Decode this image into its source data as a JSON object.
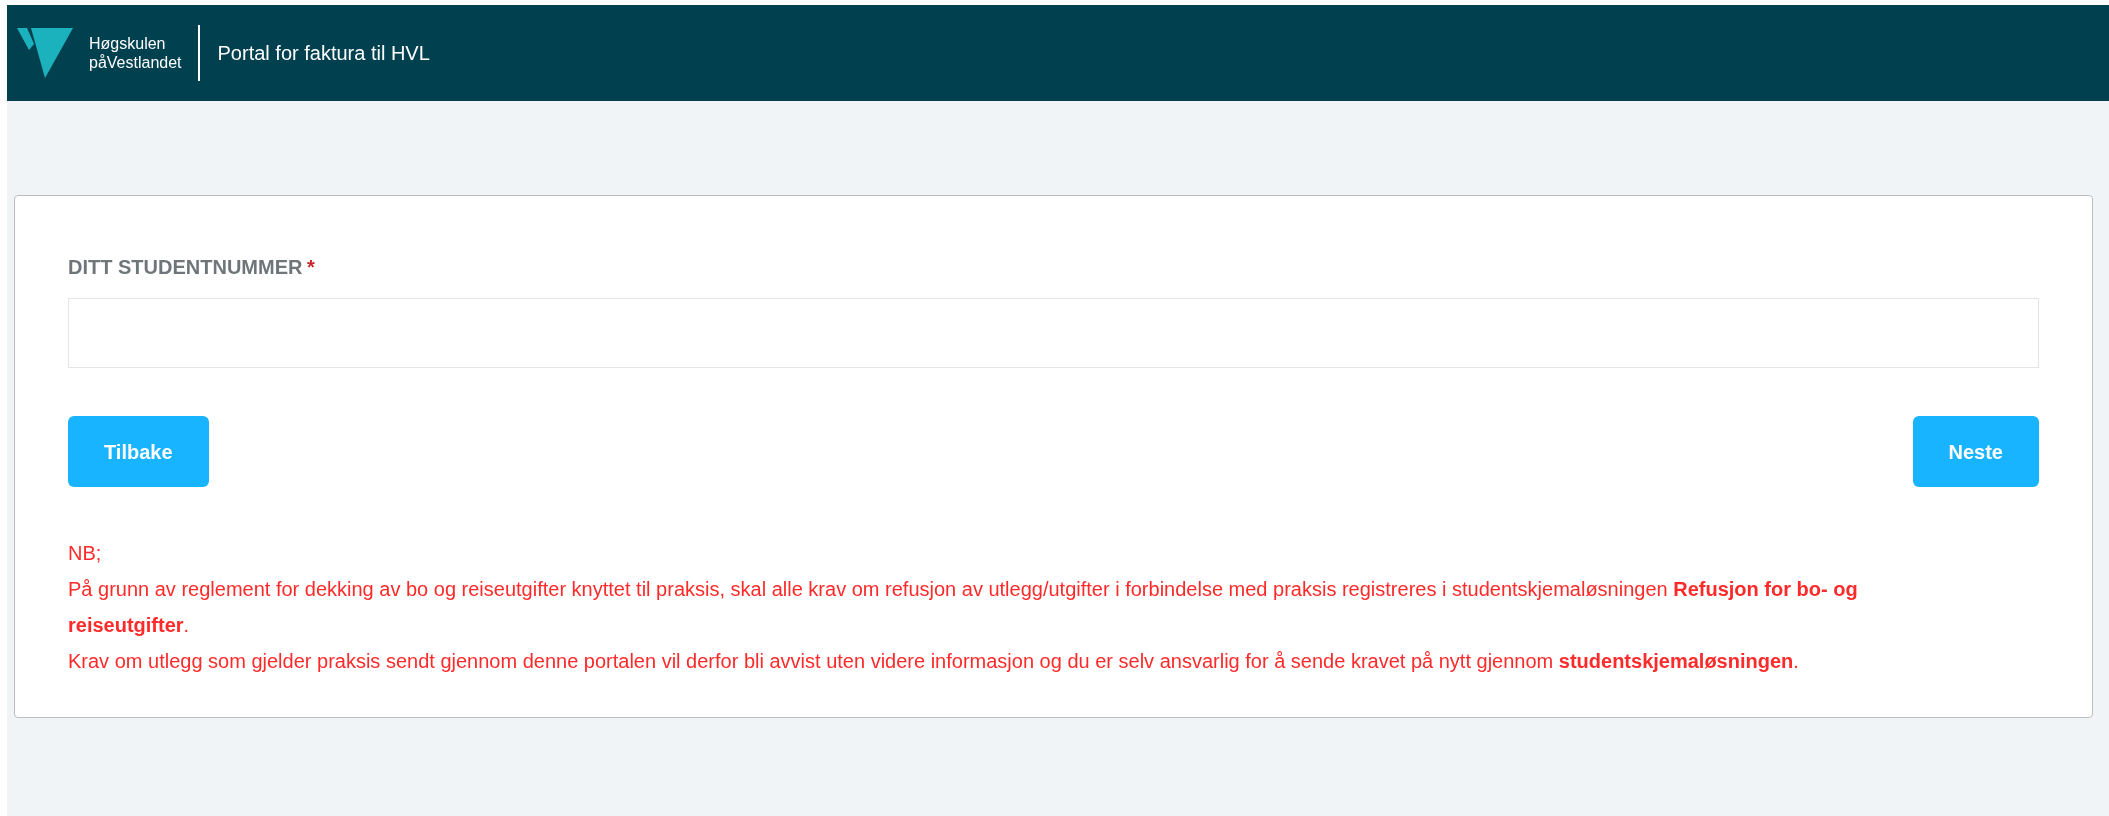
{
  "header": {
    "logo_line_1": "Høgskulen",
    "logo_line_2": "påVestlandet",
    "title": "Portal for faktura til HVL"
  },
  "form": {
    "label": "DITT STUDENTNUMMER",
    "required_mark": "*"
  },
  "buttons": [
    {
      "label": "Tilbake",
      "kind": "back"
    },
    {
      "label": "Neste",
      "kind": "next"
    }
  ],
  "notice": [
    "NB;",
    "På grunn av reglement for dekking av bo og reiseutgifter knyttet til praksis, skal alle krav om refusjon av utlegg/utgifter i forbindelse med praksis registreres i studentskjemaløsningen **Refusjon for bo- og reiseutgifter**.",
    "Krav om utlegg som gjelder praksis sendt gjennom denne portalen vil derfor bli avvist uten videre informasjon og du er selv ansvarlig for å sende kravet på nytt gjennom **studentskjemaløsningen**."
  ]
}
